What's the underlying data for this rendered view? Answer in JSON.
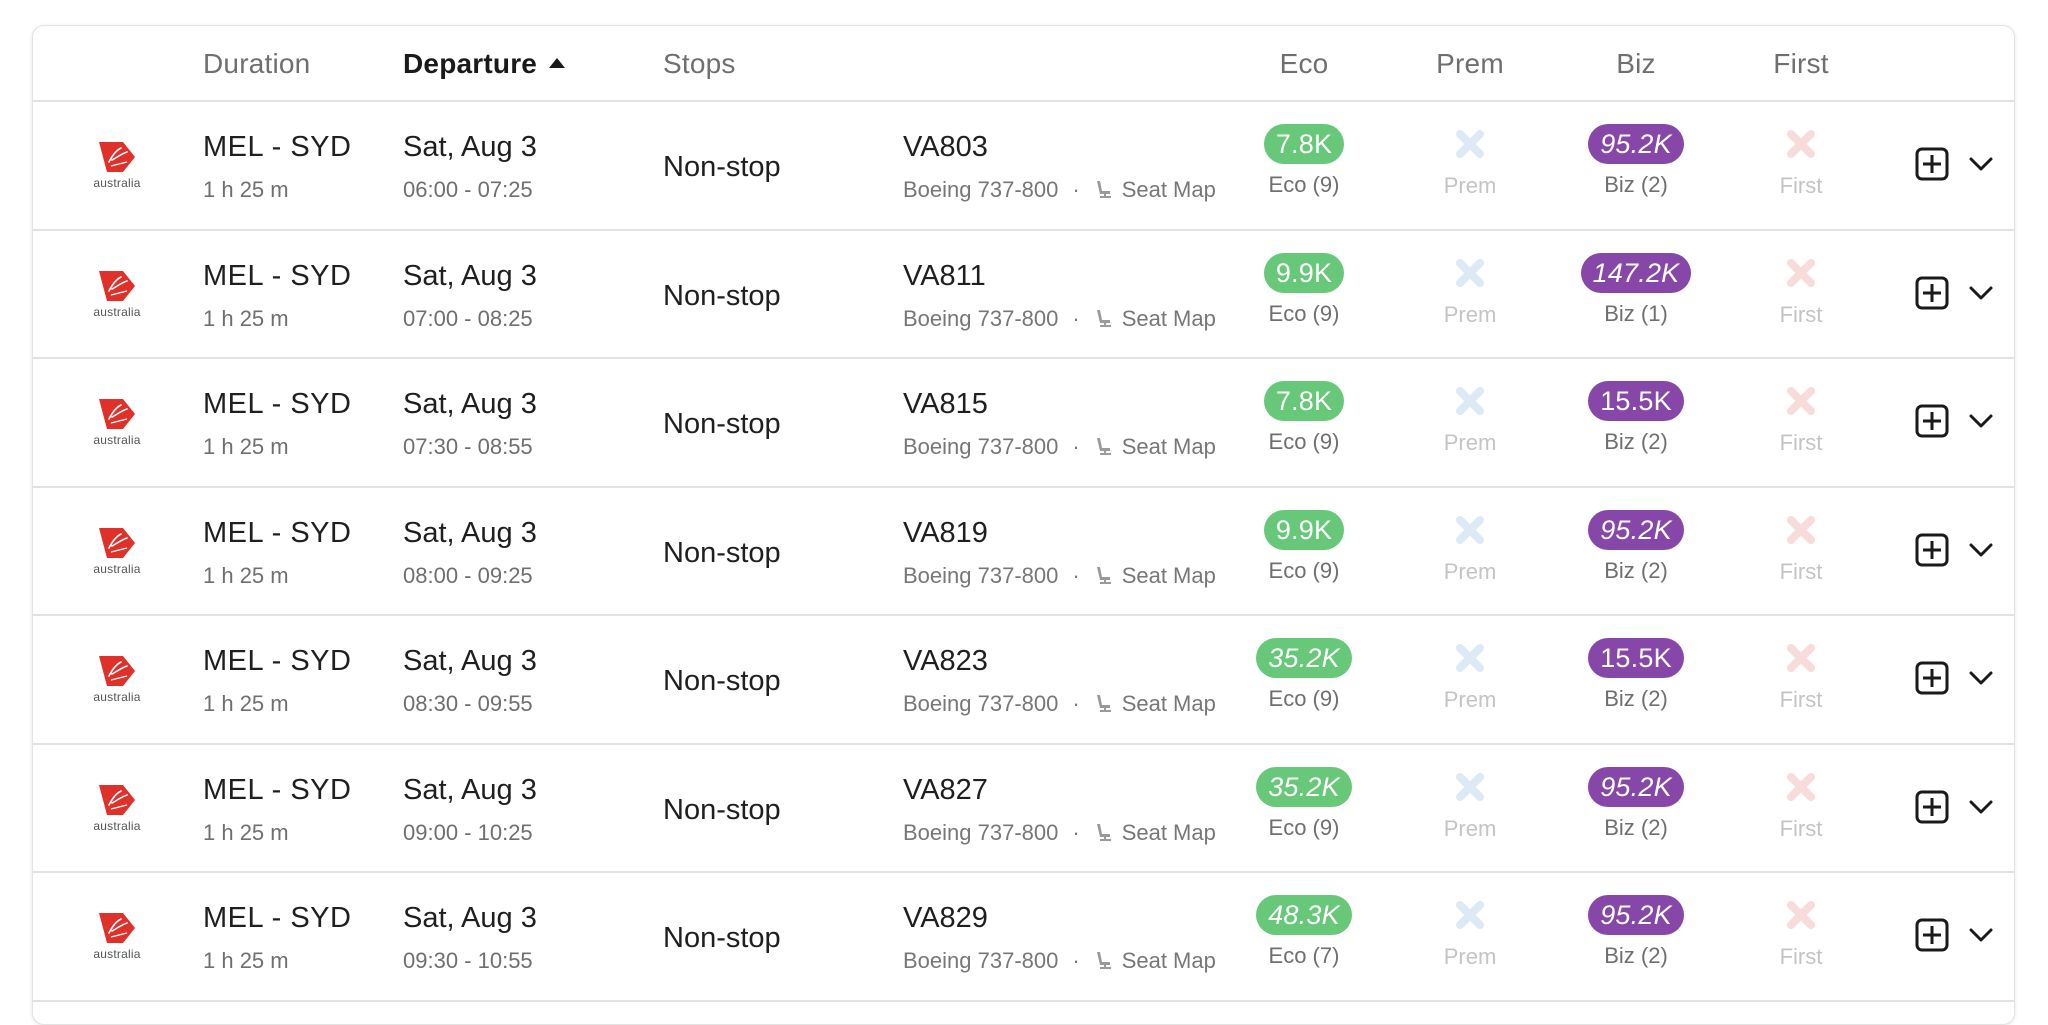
{
  "colors": {
    "eco_badge": "#66c878",
    "biz_badge": "#8647a8",
    "prem_unavailable": "#dde9f5",
    "first_unavailable": "#f8dcdc",
    "logo_red": "#e0302a"
  },
  "header": {
    "duration": "Duration",
    "departure": "Departure",
    "departure_sort": "ascending",
    "stops": "Stops",
    "eco": "Eco",
    "prem": "Prem",
    "biz": "Biz",
    "first": "First"
  },
  "icons": {
    "airline_logo": "virgin-australia-logo",
    "seat": "seat-icon",
    "prem_unavailable": "x-icon",
    "first_unavailable": "x-icon",
    "add": "plus-square-icon",
    "expand": "chevron-down-icon"
  },
  "rows": [
    {
      "airline_word": "australia",
      "route": "MEL - SYD",
      "duration": "1 h 25 m",
      "date": "Sat, Aug 3",
      "times": "06:00 - 07:25",
      "stops": "Non-stop",
      "flight": "VA803",
      "aircraft": "Boeing 737-800",
      "separator": "·",
      "seat_map": "Seat Map",
      "eco": {
        "price": "7.8K",
        "italic": false,
        "label": "Eco (9)"
      },
      "prem": {
        "label": "Prem"
      },
      "biz": {
        "price": "95.2K",
        "italic": true,
        "label": "Biz (2)"
      },
      "first": {
        "label": "First"
      }
    },
    {
      "airline_word": "australia",
      "route": "MEL - SYD",
      "duration": "1 h 25 m",
      "date": "Sat, Aug 3",
      "times": "07:00 - 08:25",
      "stops": "Non-stop",
      "flight": "VA811",
      "aircraft": "Boeing 737-800",
      "separator": "·",
      "seat_map": "Seat Map",
      "eco": {
        "price": "9.9K",
        "italic": false,
        "label": "Eco (9)"
      },
      "prem": {
        "label": "Prem"
      },
      "biz": {
        "price": "147.2K",
        "italic": true,
        "label": "Biz (1)"
      },
      "first": {
        "label": "First"
      }
    },
    {
      "airline_word": "australia",
      "route": "MEL - SYD",
      "duration": "1 h 25 m",
      "date": "Sat, Aug 3",
      "times": "07:30 - 08:55",
      "stops": "Non-stop",
      "flight": "VA815",
      "aircraft": "Boeing 737-800",
      "separator": "·",
      "seat_map": "Seat Map",
      "eco": {
        "price": "7.8K",
        "italic": false,
        "label": "Eco (9)"
      },
      "prem": {
        "label": "Prem"
      },
      "biz": {
        "price": "15.5K",
        "italic": false,
        "label": "Biz (2)"
      },
      "first": {
        "label": "First"
      }
    },
    {
      "airline_word": "australia",
      "route": "MEL - SYD",
      "duration": "1 h 25 m",
      "date": "Sat, Aug 3",
      "times": "08:00 - 09:25",
      "stops": "Non-stop",
      "flight": "VA819",
      "aircraft": "Boeing 737-800",
      "separator": "·",
      "seat_map": "Seat Map",
      "eco": {
        "price": "9.9K",
        "italic": false,
        "label": "Eco (9)"
      },
      "prem": {
        "label": "Prem"
      },
      "biz": {
        "price": "95.2K",
        "italic": true,
        "label": "Biz (2)"
      },
      "first": {
        "label": "First"
      }
    },
    {
      "airline_word": "australia",
      "route": "MEL - SYD",
      "duration": "1 h 25 m",
      "date": "Sat, Aug 3",
      "times": "08:30 - 09:55",
      "stops": "Non-stop",
      "flight": "VA823",
      "aircraft": "Boeing 737-800",
      "separator": "·",
      "seat_map": "Seat Map",
      "eco": {
        "price": "35.2K",
        "italic": true,
        "label": "Eco (9)"
      },
      "prem": {
        "label": "Prem"
      },
      "biz": {
        "price": "15.5K",
        "italic": false,
        "label": "Biz (2)"
      },
      "first": {
        "label": "First"
      }
    },
    {
      "airline_word": "australia",
      "route": "MEL - SYD",
      "duration": "1 h 25 m",
      "date": "Sat, Aug 3",
      "times": "09:00 - 10:25",
      "stops": "Non-stop",
      "flight": "VA827",
      "aircraft": "Boeing 737-800",
      "separator": "·",
      "seat_map": "Seat Map",
      "eco": {
        "price": "35.2K",
        "italic": true,
        "label": "Eco (9)"
      },
      "prem": {
        "label": "Prem"
      },
      "biz": {
        "price": "95.2K",
        "italic": true,
        "label": "Biz (2)"
      },
      "first": {
        "label": "First"
      }
    },
    {
      "airline_word": "australia",
      "route": "MEL - SYD",
      "duration": "1 h 25 m",
      "date": "Sat, Aug 3",
      "times": "09:30 - 10:55",
      "stops": "Non-stop",
      "flight": "VA829",
      "aircraft": "Boeing 737-800",
      "separator": "·",
      "seat_map": "Seat Map",
      "eco": {
        "price": "48.3K",
        "italic": true,
        "label": "Eco (7)"
      },
      "prem": {
        "label": "Prem"
      },
      "biz": {
        "price": "95.2K",
        "italic": true,
        "label": "Biz (2)"
      },
      "first": {
        "label": "First"
      }
    }
  ]
}
